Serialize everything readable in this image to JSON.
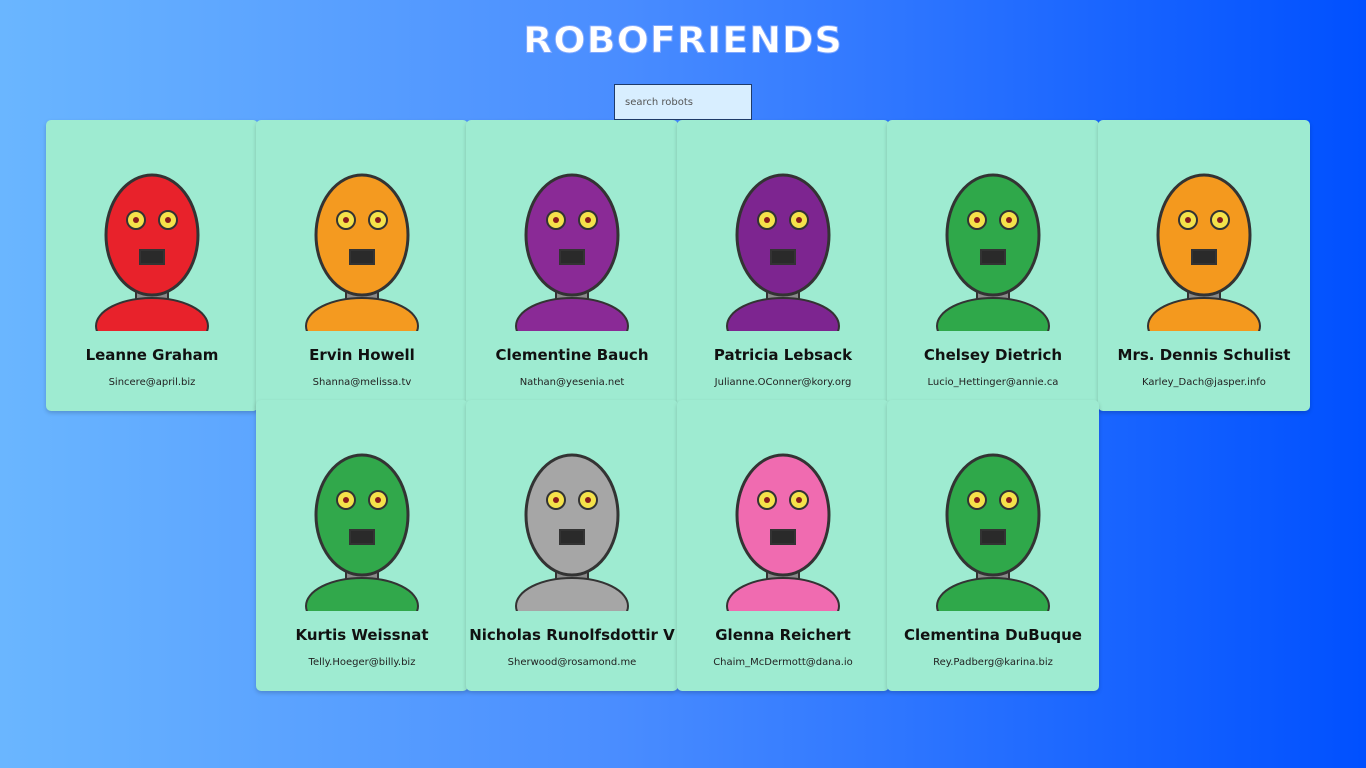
{
  "app": {
    "title": "ROBOFRIENDS"
  },
  "search": {
    "placeholder": "search robots",
    "value": ""
  },
  "robots": [
    {
      "name": "Leanne Graham",
      "email": "Sincere@april.biz",
      "color": "#e8222b"
    },
    {
      "name": "Ervin Howell",
      "email": "Shanna@melissa.tv",
      "color": "#f49a20"
    },
    {
      "name": "Clementine Bauch",
      "email": "Nathan@yesenia.net",
      "color": "#8a2a96"
    },
    {
      "name": "Patricia Lebsack",
      "email": "Julianne.OConner@kory.org",
      "color": "#7d2590"
    },
    {
      "name": "Chelsey Dietrich",
      "email": "Lucio_Hettinger@annie.ca",
      "color": "#2fa84a"
    },
    {
      "name": "Mrs. Dennis Schulist",
      "email": "Karley_Dach@jasper.info",
      "color": "#f4991e"
    },
    {
      "name": "Kurtis Weissnat",
      "email": "Telly.Hoeger@billy.biz",
      "color": "#31a84b"
    },
    {
      "name": "Nicholas Runolfsdottir V",
      "email": "Sherwood@rosamond.me",
      "color": "#a6a6a6"
    },
    {
      "name": "Glenna Reichert",
      "email": "Chaim_McDermott@dana.io",
      "color": "#f06bb0"
    },
    {
      "name": "Clementina DuBuque",
      "email": "Rey.Padberg@karina.biz",
      "color": "#2fa84a"
    }
  ]
}
